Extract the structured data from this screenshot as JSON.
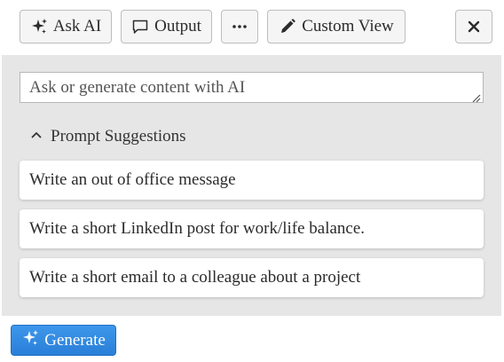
{
  "toolbar": {
    "ask_ai_label": "Ask AI",
    "output_label": "Output",
    "more_label": "⋯",
    "custom_view_label": "Custom View",
    "icons": {
      "ask_ai": "sparkles-icon",
      "output": "speech-bubble-icon",
      "custom_view": "pencil-icon",
      "close": "close-icon"
    }
  },
  "prompt": {
    "placeholder": "Ask or generate content with AI",
    "value": ""
  },
  "suggestions": {
    "header_label": "Prompt Suggestions",
    "expanded": true,
    "items": [
      {
        "label": "Write an out of office message"
      },
      {
        "label": "Write a short LinkedIn post for work/life balance."
      },
      {
        "label": "Write a short email to a colleague about a project"
      }
    ]
  },
  "generate": {
    "label": "Generate"
  },
  "colors": {
    "panel_bg": "#e6e6e6",
    "primary_button": "#2a7fd8",
    "toolbar_button_bg": "#f5f5f5"
  }
}
